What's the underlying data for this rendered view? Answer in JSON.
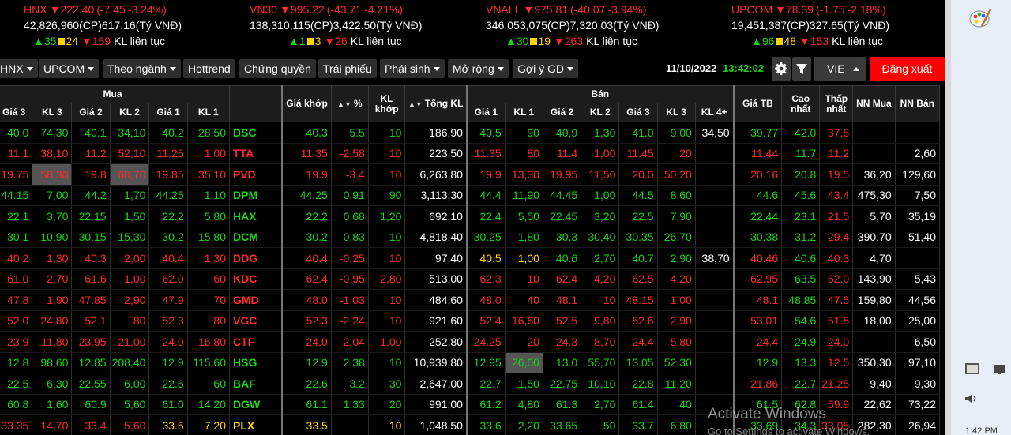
{
  "indices": [
    {
      "name": "HNX",
      "value": "▼222.40",
      "change": "(-7.45",
      "pct": "-3.24%)",
      "volume": "42,826,960",
      "vol_unit": "(CP)",
      "turnover": "617.16",
      "turn_unit": "(Tỷ VNĐ)",
      "up": "35",
      "ref": "24",
      "down": "159",
      "note": "KL liên tục"
    },
    {
      "name": "VN30",
      "value": "▼995.22",
      "change": "(-43.71",
      "pct": "-4.21%)",
      "volume": "138,310,115",
      "vol_unit": "(CP)",
      "turnover": "3,422.50",
      "turn_unit": "(Tỷ VNĐ)",
      "up": "1",
      "ref": "3",
      "down": "26",
      "note": "KL liên tục"
    },
    {
      "name": "VNALL",
      "value": "▼975.81",
      "change": "(-40.07",
      "pct": "-3.94%)",
      "volume": "346,053,075",
      "vol_unit": "(CP)",
      "turnover": "7,320.03",
      "turn_unit": "(Tỷ VNĐ)",
      "up": "30",
      "ref": "19",
      "down": "263",
      "note": "KL liên tục"
    },
    {
      "name": "UPCOM",
      "value": "▼78.39",
      "change": "(-1.75",
      "pct": "-2.18%)",
      "volume": "19,451,387",
      "vol_unit": "(CP)",
      "turnover": "327.65",
      "turn_unit": "(Tỷ VNĐ)",
      "up": "96",
      "ref": "48",
      "down": "153",
      "note": "KL liên tục"
    }
  ],
  "toolbar": {
    "buttons": [
      "HNX",
      "UPCOM",
      "Theo ngành",
      "Hottrend",
      "Chứng quyền",
      "Trái phiếu",
      "Phái sinh",
      "Mở rộng",
      "Gợi ý GD"
    ],
    "date": "11/10/2022",
    "time": "13:42:02",
    "lang": "VIE",
    "logout": "Đăng xuất"
  },
  "header": {
    "buy_group": "Mua",
    "sell_group": "Bán",
    "cols": {
      "b_p3": "Giá 3",
      "b_v3": "KL 3",
      "b_p2": "Giá 2",
      "b_v2": "KL 2",
      "b_p1": "Giá 1",
      "b_v1": "KL 1",
      "match_price": "Giá khớp",
      "pct": "%",
      "match_vol": "KL khớp",
      "total_vol": "Tổng KL",
      "s_p1": "Giá 1",
      "s_v1": "KL 1",
      "s_p2": "Giá 2",
      "s_v2": "KL 2",
      "s_p3": "Giá 3",
      "s_v3": "KL 3",
      "s_v4": "KL 4+",
      "avg": "Giá TB",
      "high": "Cao nhất",
      "low": "Thấp nhất",
      "nn_buy": "NN Mua",
      "nn_sell": "NN Bán"
    }
  },
  "colors": {
    "up": "#17d417",
    "down": "#ff2a2a",
    "ref": "#ffd400",
    "white": "#ffffff"
  },
  "rows": [
    {
      "sym": "DSC",
      "c": [
        "40.0",
        "74,30",
        "40.1",
        "34,10",
        "40.2",
        "28,50",
        "40.3",
        "5.5",
        "10",
        "186,90",
        "40.5",
        "90",
        "40.9",
        "1,30",
        "41.0",
        "9,00",
        "34,50",
        "39.77",
        "42.0",
        "37.8",
        "",
        ""
      ],
      "k": [
        "u",
        "u",
        "u",
        "u",
        "u",
        "u",
        "u",
        "u",
        "u",
        "w",
        "u",
        "u",
        "u",
        "u",
        "u",
        "u",
        "w",
        "u",
        "u",
        "d",
        "w",
        "w"
      ]
    },
    {
      "sym": "TTA",
      "c": [
        "11.1",
        "38,10",
        "11.2",
        "52,10",
        "11.25",
        "1,00",
        "11.35",
        "-2.58",
        "10",
        "223,50",
        "11.35",
        "80",
        "11.4",
        "1,00",
        "11.45",
        "20",
        "",
        "11.44",
        "11.7",
        "11.2",
        "",
        "2,60"
      ],
      "k": [
        "d",
        "d",
        "d",
        "d",
        "d",
        "d",
        "d",
        "d",
        "d",
        "w",
        "d",
        "d",
        "d",
        "d",
        "d",
        "d",
        "w",
        "d",
        "u",
        "d",
        "w",
        "w"
      ]
    },
    {
      "sym": "PVD",
      "c": [
        "19.75",
        "58,30",
        "19.8",
        "68,70",
        "19.85",
        "35,10",
        "19.9",
        "-3.4",
        "10",
        "6,263,80",
        "19.9",
        "13,30",
        "19.95",
        "11,50",
        "20.0",
        "50,20",
        "",
        "20.16",
        "20.8",
        "19.5",
        "36,20",
        "129,60"
      ],
      "k": [
        "d",
        "d",
        "d",
        "d",
        "d",
        "d",
        "d",
        "d",
        "d",
        "w",
        "d",
        "d",
        "d",
        "d",
        "d",
        "d",
        "w",
        "d",
        "u",
        "d",
        "w",
        "w"
      ],
      "hl": [
        1,
        3
      ]
    },
    {
      "sym": "DPM",
      "c": [
        "44.15",
        "7,00",
        "44.2",
        "1,70",
        "44.25",
        "1,10",
        "44.25",
        "0.91",
        "90",
        "3,113,30",
        "44.4",
        "11,90",
        "44.45",
        "1,00",
        "44.5",
        "8,60",
        "",
        "44.6",
        "45.6",
        "43.4",
        "475,30",
        "7,50"
      ],
      "k": [
        "u",
        "u",
        "u",
        "u",
        "u",
        "u",
        "u",
        "u",
        "u",
        "w",
        "u",
        "u",
        "u",
        "u",
        "u",
        "u",
        "w",
        "u",
        "u",
        "d",
        "w",
        "w"
      ]
    },
    {
      "sym": "HAX",
      "c": [
        "22.1",
        "3,70",
        "22.15",
        "1,50",
        "22.2",
        "5,80",
        "22.2",
        "0.68",
        "1,20",
        "692,10",
        "22.4",
        "5,50",
        "22.45",
        "3,20",
        "22.5",
        "7,90",
        "",
        "22.44",
        "23.1",
        "21.5",
        "5,70",
        "35,19"
      ],
      "k": [
        "u",
        "u",
        "u",
        "u",
        "u",
        "u",
        "u",
        "u",
        "u",
        "w",
        "u",
        "u",
        "u",
        "u",
        "u",
        "u",
        "w",
        "u",
        "u",
        "d",
        "w",
        "w"
      ]
    },
    {
      "sym": "DCM",
      "c": [
        "30.1",
        "10,90",
        "30.15",
        "15,30",
        "30.2",
        "15,80",
        "30.2",
        "0.83",
        "10",
        "4,818,40",
        "30.25",
        "1,80",
        "30.3",
        "30,40",
        "30.35",
        "26,70",
        "",
        "30.38",
        "31.2",
        "29.4",
        "390,70",
        "51,40"
      ],
      "k": [
        "u",
        "u",
        "u",
        "u",
        "u",
        "u",
        "u",
        "u",
        "u",
        "w",
        "u",
        "u",
        "u",
        "u",
        "u",
        "u",
        "w",
        "u",
        "u",
        "d",
        "w",
        "w"
      ]
    },
    {
      "sym": "DDG",
      "c": [
        "40.2",
        "1,30",
        "40.3",
        "2,00",
        "40.4",
        "1,30",
        "40.4",
        "-0.25",
        "10",
        "97,40",
        "40.5",
        "1,00",
        "40.6",
        "2,70",
        "40.7",
        "2,90",
        "38,70",
        "40.46",
        "40.6",
        "40.3",
        "4,70",
        ""
      ],
      "k": [
        "d",
        "d",
        "d",
        "d",
        "d",
        "d",
        "d",
        "d",
        "d",
        "w",
        "r",
        "r",
        "u",
        "u",
        "u",
        "u",
        "w",
        "d",
        "u",
        "d",
        "w",
        "w"
      ]
    },
    {
      "sym": "KDC",
      "c": [
        "61.0",
        "2,70",
        "61.6",
        "1,00",
        "62.0",
        "60",
        "62.4",
        "-0.95",
        "2,80",
        "513,00",
        "62.3",
        "10",
        "62.4",
        "4,20",
        "62.5",
        "4,20",
        "",
        "62.95",
        "63.5",
        "62.0",
        "143,90",
        "5,43"
      ],
      "k": [
        "d",
        "d",
        "d",
        "d",
        "d",
        "d",
        "d",
        "d",
        "d",
        "w",
        "d",
        "d",
        "d",
        "d",
        "d",
        "d",
        "w",
        "d",
        "u",
        "d",
        "w",
        "w"
      ]
    },
    {
      "sym": "GMD",
      "c": [
        "47.8",
        "1,90",
        "47.85",
        "2,90",
        "47.9",
        "70",
        "48.0",
        "-1.03",
        "10",
        "484,60",
        "48.0",
        "40",
        "48.1",
        "10",
        "48.15",
        "1,00",
        "",
        "48.1",
        "48.85",
        "47.5",
        "159,80",
        "44,56"
      ],
      "k": [
        "d",
        "d",
        "d",
        "d",
        "d",
        "d",
        "d",
        "d",
        "d",
        "w",
        "d",
        "d",
        "d",
        "d",
        "d",
        "d",
        "w",
        "d",
        "u",
        "d",
        "w",
        "w"
      ]
    },
    {
      "sym": "VGC",
      "c": [
        "52.0",
        "24,80",
        "52.1",
        "80",
        "52.3",
        "80",
        "52.3",
        "-2.24",
        "10",
        "921,60",
        "52.4",
        "16,60",
        "52.5",
        "9,80",
        "52.6",
        "2,90",
        "",
        "53.01",
        "54.6",
        "51.5",
        "18,00",
        "25,00"
      ],
      "k": [
        "d",
        "d",
        "d",
        "d",
        "d",
        "d",
        "d",
        "d",
        "d",
        "w",
        "d",
        "d",
        "d",
        "d",
        "d",
        "d",
        "w",
        "d",
        "u",
        "d",
        "w",
        "w"
      ]
    },
    {
      "sym": "CTF",
      "c": [
        "23.9",
        "11,80",
        "23.95",
        "21,00",
        "24.0",
        "16,80",
        "24.0",
        "-2.04",
        "1,00",
        "252,80",
        "24.25",
        "20",
        "24.3",
        "8,70",
        "24.4",
        "5,80",
        "",
        "24.4",
        "24.9",
        "24.0",
        "",
        "6,50"
      ],
      "k": [
        "d",
        "d",
        "d",
        "d",
        "d",
        "d",
        "d",
        "d",
        "d",
        "w",
        "d",
        "d",
        "d",
        "d",
        "d",
        "d",
        "w",
        "d",
        "u",
        "d",
        "w",
        "w"
      ]
    },
    {
      "sym": "HSG",
      "c": [
        "12.8",
        "98,60",
        "12.85",
        "208,40",
        "12.9",
        "115,60",
        "12.9",
        "2.38",
        "10",
        "10,939,80",
        "12.95",
        "26,00",
        "13.0",
        "55,70",
        "13.05",
        "52,30",
        "",
        "12.9",
        "13.3",
        "12.5",
        "350,30",
        "97,10"
      ],
      "k": [
        "u",
        "u",
        "u",
        "u",
        "u",
        "u",
        "u",
        "u",
        "u",
        "w",
        "u",
        "u",
        "u",
        "u",
        "u",
        "u",
        "w",
        "u",
        "u",
        "d",
        "w",
        "w"
      ],
      "hl": [
        11
      ]
    },
    {
      "sym": "BAF",
      "c": [
        "22.5",
        "6,30",
        "22.55",
        "6,00",
        "22.6",
        "60",
        "22.6",
        "3.2",
        "30",
        "2,647,00",
        "22.7",
        "1,50",
        "22.75",
        "10,10",
        "22.8",
        "11,20",
        "",
        "21.86",
        "22.7",
        "21.25",
        "9,40",
        "9,30"
      ],
      "k": [
        "u",
        "u",
        "u",
        "u",
        "u",
        "u",
        "u",
        "u",
        "u",
        "w",
        "u",
        "u",
        "u",
        "u",
        "u",
        "u",
        "w",
        "d",
        "u",
        "d",
        "w",
        "w"
      ]
    },
    {
      "sym": "DGW",
      "c": [
        "60.8",
        "1,60",
        "60.9",
        "5,60",
        "61.0",
        "14,20",
        "61.1",
        "1.33",
        "20",
        "991,00",
        "61.2",
        "4,80",
        "61.3",
        "2,70",
        "61.4",
        "40",
        "",
        "61.5",
        "62.8",
        "59.9",
        "22,62",
        "73,22"
      ],
      "k": [
        "u",
        "u",
        "u",
        "u",
        "u",
        "u",
        "u",
        "u",
        "u",
        "w",
        "u",
        "u",
        "u",
        "u",
        "u",
        "u",
        "w",
        "u",
        "u",
        "d",
        "w",
        "w"
      ]
    },
    {
      "sym": "PLX",
      "c": [
        "33.35",
        "14,70",
        "33.4",
        "5,60",
        "33.5",
        "7,20",
        "33.5",
        "",
        "10",
        "1,048,50",
        "33.6",
        "2,20",
        "33.65",
        "50",
        "33.7",
        "6,80",
        "",
        "33.69",
        "34.3",
        "33.05",
        "282,30",
        "26,94"
      ],
      "k": [
        "d",
        "d",
        "d",
        "d",
        "r",
        "r",
        "r",
        "r",
        "r",
        "w",
        "u",
        "u",
        "u",
        "u",
        "u",
        "u",
        "w",
        "u",
        "u",
        "d",
        "w",
        "w"
      ]
    }
  ],
  "watermark": {
    "title": "Activate Windows",
    "sub": "Go to Settings to activate Windows."
  },
  "tray": {
    "time": "1:42 PM"
  }
}
